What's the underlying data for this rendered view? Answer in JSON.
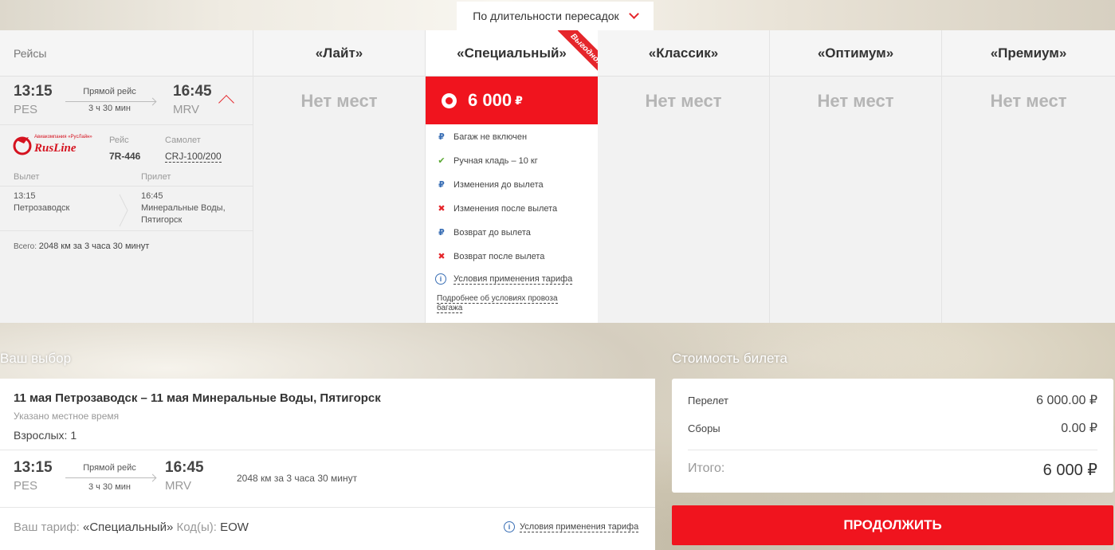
{
  "sort": {
    "label": "По длительности пересадок"
  },
  "flights_header": "Рейсы",
  "tariffs": [
    {
      "name": "«Лайт»",
      "status": "Нет мест"
    },
    {
      "name": "«Специальный»",
      "price": "6 000",
      "currency": "₽",
      "badge": "Выгодно!"
    },
    {
      "name": "«Классик»",
      "status": "Нет мест"
    },
    {
      "name": "«Оптимум»",
      "status": "Нет мест"
    },
    {
      "name": "«Премиум»",
      "status": "Нет мест"
    }
  ],
  "flight": {
    "dep_time": "13:15",
    "dep_code": "PES",
    "type": "Прямой рейс",
    "duration": "3 ч 30 мин",
    "arr_time": "16:45",
    "arr_code": "MRV",
    "airline_logo": "RusLine",
    "airline_sub": "Авиакомпания «РусЛайн»",
    "flight_label": "Рейс",
    "flight_no": "7R-446",
    "aircraft_label": "Самолет",
    "aircraft": "CRJ-100/200",
    "dep_label": "Вылет",
    "arr_label": "Прилет",
    "dep_city": "Петрозаводск",
    "arr_city1": "Минеральные Воды,",
    "arr_city2": "Пятигорск",
    "total_label": "Всего:",
    "total": "2048 км за 3 часа 30 минут"
  },
  "features": [
    {
      "icon": "rub",
      "text": "Багаж не включен"
    },
    {
      "icon": "check",
      "text": "Ручная кладь – 10 кг"
    },
    {
      "icon": "rub",
      "text": "Изменения до вылета"
    },
    {
      "icon": "cross",
      "text": "Изменения после вылета"
    },
    {
      "icon": "rub",
      "text": "Возврат до вылета"
    },
    {
      "icon": "cross",
      "text": "Возврат после вылета"
    }
  ],
  "conditions_link": "Условия применения тарифа",
  "baggage_link1": "Подробнее об условиях провоза",
  "baggage_link2": "багажа",
  "choice": {
    "title": "Ваш выбор",
    "route": "11 мая Петрозаводск – 11 мая Минеральные Воды, Пятигорск",
    "local_time": "Указано местное время",
    "adults": "Взрослых: 1",
    "distance": "2048 км за 3 часа 30 минут",
    "tariff_prefix": "Ваш тариф: ",
    "tariff_name": "«Специальный»",
    "code_label": " Код(ы): ",
    "code": "EOW",
    "conditions": "Условия применения тарифа"
  },
  "cost": {
    "title": "Стоимость билета",
    "flight_label": "Перелет",
    "flight_value": "6 000.00 ₽",
    "fees_label": "Сборы",
    "fees_value": "0.00 ₽",
    "total_label": "Итого:",
    "total_value": "6 000 ₽"
  },
  "continue_label": "ПРОДОЛЖИТЬ",
  "colors": {
    "accent": "#f0141e",
    "link": "#3a6fb5"
  }
}
